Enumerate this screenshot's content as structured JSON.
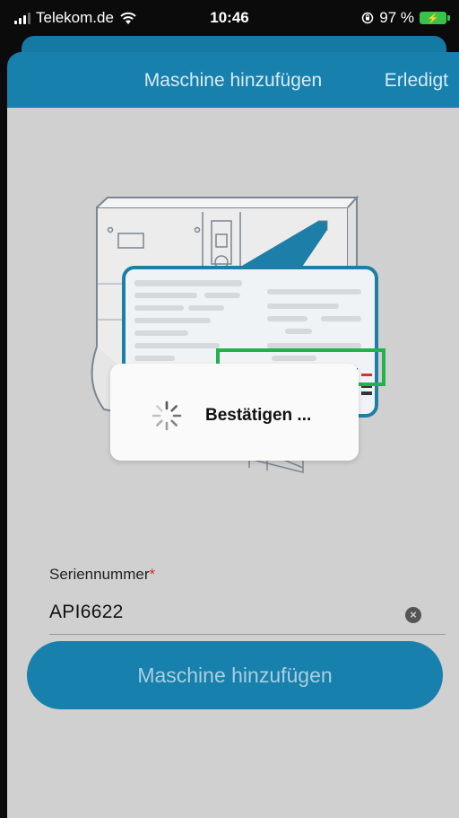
{
  "status_bar": {
    "carrier": "Telekom.de",
    "time": "10:46",
    "battery_percent": "97 %",
    "icons": [
      "signal-icon",
      "wifi-icon",
      "orientation-lock-icon",
      "battery-charging-icon"
    ]
  },
  "nav": {
    "title": "Maschine hinzufügen",
    "done_label": "Erledigt"
  },
  "form": {
    "serial_label": "Seriennummer",
    "required_marker": "*",
    "serial_value": "API6622"
  },
  "submit_label": "Maschine hinzufügen",
  "loading": {
    "message": "Bestätigen ..."
  },
  "colors": {
    "brand_blue": "#1780ac",
    "background_gray": "#d0d0d0",
    "highlight_green": "#22b24c",
    "required_red": "#d9302c"
  }
}
